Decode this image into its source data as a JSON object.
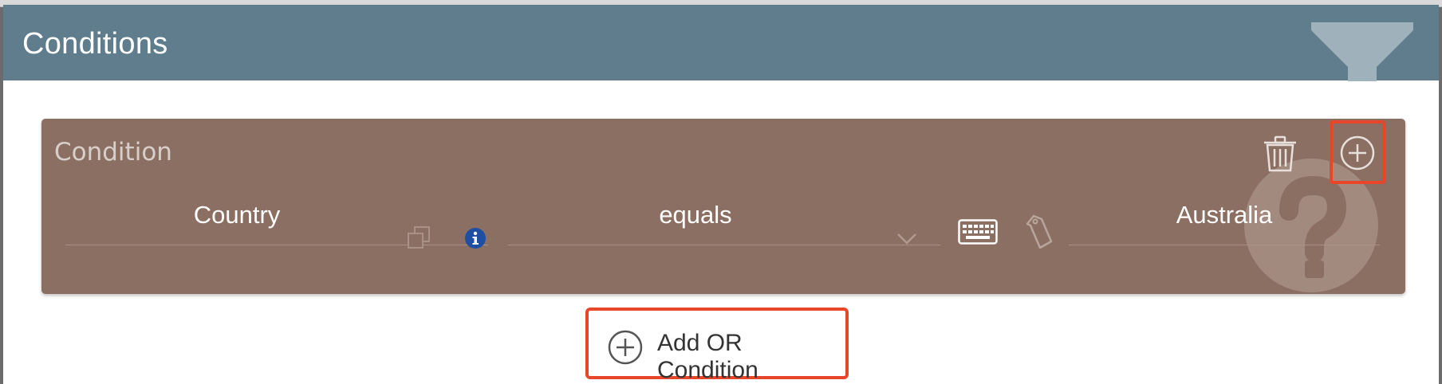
{
  "dialog": {
    "title": "Conditions",
    "header_icon": "funnel-icon"
  },
  "condition": {
    "title": "Condition",
    "icons": [
      "trash-icon",
      "plus-circle-icon",
      "help-icon"
    ],
    "field": {
      "value": "Country",
      "icons": [
        "copy-icon",
        "info-icon"
      ]
    },
    "operator": {
      "selected": "equals",
      "icon": "chevron-down-icon"
    },
    "value_input": {
      "value": "Australia",
      "icons": [
        "keyboard-icon",
        "tag-icon"
      ]
    }
  },
  "add_or_button": {
    "label": "Add OR Condition",
    "icon": "plus-circle-icon"
  },
  "colors": {
    "header": "#5f7d8c",
    "condition_card": "#8c6f63",
    "highlight": "#e8462a",
    "info": "#1f4fa3"
  }
}
